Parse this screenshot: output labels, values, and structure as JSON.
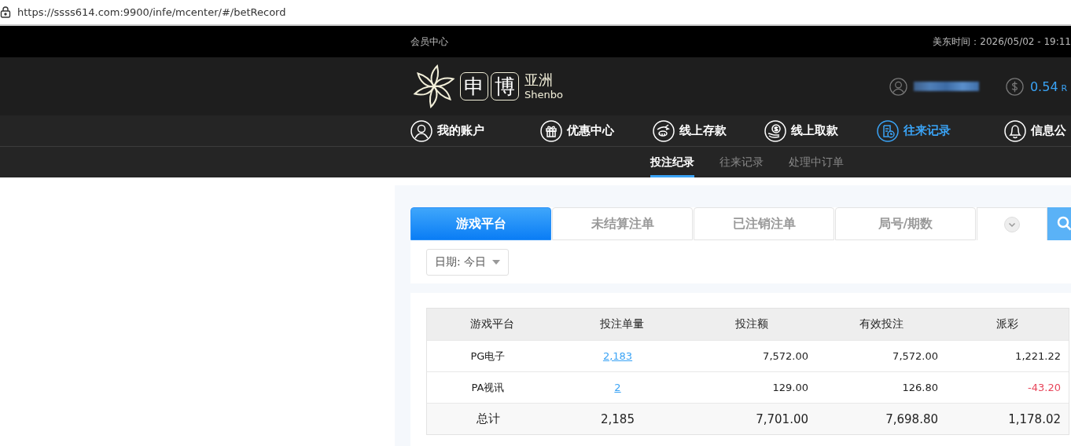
{
  "browser": {
    "url": "https://ssss614.com:9900/infe/mcenter/#/betRecord"
  },
  "top_bar": {
    "title": "会员中心",
    "time": "美东时间：2026/05/02 - 19:11"
  },
  "header": {
    "logo_chars": [
      "申",
      "博"
    ],
    "logo_name": "亚洲",
    "logo_latin": "Shenbo",
    "balance": "0.54",
    "currency": "R"
  },
  "nav": [
    {
      "label": "我的账户",
      "selected": false
    },
    {
      "label": "优惠中心",
      "selected": false
    },
    {
      "label": "线上存款",
      "selected": false
    },
    {
      "label": "线上取款",
      "selected": false
    },
    {
      "label": "往来记录",
      "selected": true
    },
    {
      "label": "信息公",
      "selected": false
    }
  ],
  "sub_nav": [
    {
      "label": "投注纪录",
      "selected": true
    },
    {
      "label": "往来记录",
      "selected": false
    },
    {
      "label": "处理中订单",
      "selected": false
    }
  ],
  "filter_tabs": [
    {
      "label": "游戏平台",
      "selected": true
    },
    {
      "label": "未结算注单",
      "selected": false
    },
    {
      "label": "已注销注单",
      "selected": false
    },
    {
      "label": "局号/期数",
      "selected": false
    }
  ],
  "date_filter": {
    "label": "日期: 今日"
  },
  "table": {
    "columns": [
      "游戏平台",
      "投注单量",
      "投注额",
      "有效投注",
      "派彩"
    ],
    "rows": [
      {
        "platform": "PG电子",
        "count": "2,183",
        "bet": "7,572.00",
        "valid": "7,572.00",
        "payout": "1,221.22",
        "negative": false
      },
      {
        "platform": "PA视讯",
        "count": "2",
        "bet": "129.00",
        "valid": "126.80",
        "payout": "-43.20",
        "negative": true
      }
    ],
    "total": {
      "label": "总计",
      "count": "2,185",
      "bet": "7,701.00",
      "valid": "7,698.80",
      "payout": "1,178.02"
    }
  }
}
